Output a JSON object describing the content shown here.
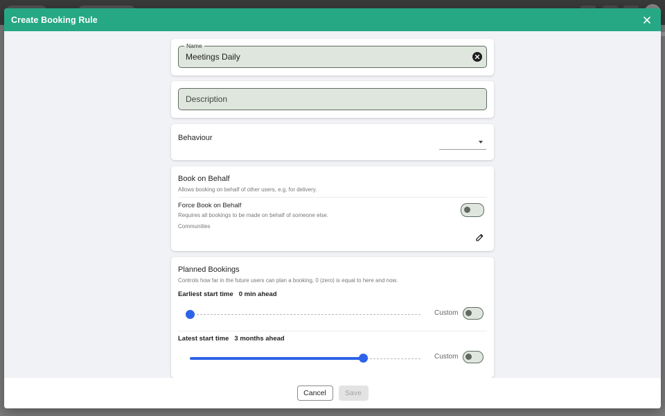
{
  "dialog": {
    "title": "Create Booking Rule",
    "close_icon": "close-icon"
  },
  "name_field": {
    "legend": "Name",
    "value": "Meetings Daily",
    "clear_icon": "clear-circle-icon"
  },
  "description_field": {
    "placeholder": "Description"
  },
  "behaviour": {
    "title": "Behaviour",
    "dropdown_icon": "caret-down-icon"
  },
  "book_on_behalf": {
    "title": "Book on Behalf",
    "subtitle": "Allows booking on behalf of other users, e.g. for delivery.",
    "force_label": "Force Book on Behalf",
    "force_sub": "Requires all bookings to be made on behalf of someone else.",
    "force_enabled": false,
    "communities_label": "Communities",
    "edit_icon": "pencil-icon"
  },
  "planned_bookings": {
    "title": "Planned Bookings",
    "subtitle": "Controls how far in the future users can plan a booking, 0 (zero) is equal to here and now.",
    "earliest": {
      "label": "Earliest start time",
      "value": "0 min ahead",
      "slider_fraction": 0.0,
      "custom_label": "Custom",
      "custom_enabled": false
    },
    "latest": {
      "label": "Latest start time",
      "value": "3 months ahead",
      "slider_fraction": 0.75,
      "custom_label": "Custom",
      "custom_enabled": false
    }
  },
  "footer": {
    "cancel_label": "Cancel",
    "save_label": "Save",
    "save_enabled": false
  },
  "colors": {
    "header": "#26a884",
    "slider": "#2d63e8",
    "field_bg": "#dfe6dd"
  }
}
